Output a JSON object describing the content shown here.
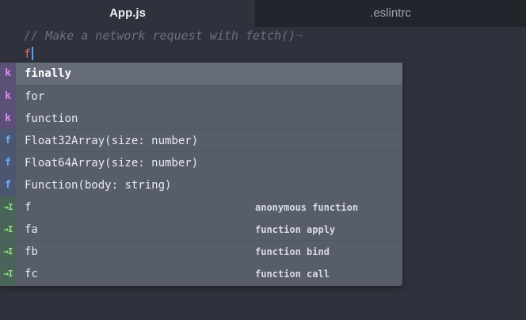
{
  "tabs": [
    {
      "label": "App.js",
      "active": true
    },
    {
      "label": ".eslintrc",
      "active": false
    }
  ],
  "editor": {
    "comment": "// Make a network request with fetch()",
    "eol_marker": "¬",
    "typed": "f"
  },
  "autocomplete": {
    "items": [
      {
        "badge": "k",
        "kind": "keyword",
        "label": "finally",
        "description": "",
        "selected": true
      },
      {
        "badge": "k",
        "kind": "keyword",
        "label": "for",
        "description": ""
      },
      {
        "badge": "k",
        "kind": "keyword",
        "label": "function",
        "description": ""
      },
      {
        "badge": "f",
        "kind": "function",
        "label": "Float32Array(size: number)",
        "description": ""
      },
      {
        "badge": "f",
        "kind": "function",
        "label": "Float64Array(size: number)",
        "description": ""
      },
      {
        "badge": "f",
        "kind": "function",
        "label": "Function(body: string)",
        "description": ""
      },
      {
        "badge": "→I",
        "kind": "snippet",
        "label": "f",
        "description": "anonymous function"
      },
      {
        "badge": "→I",
        "kind": "snippet",
        "label": "fa",
        "description": "function apply"
      },
      {
        "badge": "→I",
        "kind": "snippet",
        "label": "fb",
        "description": "function bind"
      },
      {
        "badge": "→I",
        "kind": "snippet",
        "label": "fc",
        "description": "function call"
      }
    ]
  },
  "colors": {
    "keyword_badge": "#d98ef0",
    "function_badge": "#6ea9f2",
    "snippet_badge": "#8fe08a",
    "cursor": "#5b9ff5"
  }
}
